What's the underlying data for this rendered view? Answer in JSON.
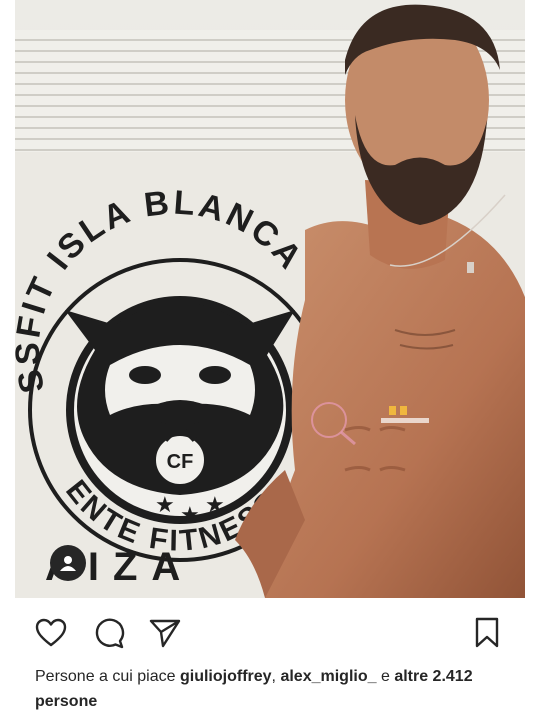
{
  "post": {
    "logo_text_top": "SSFIT ISLA BLANCA",
    "logo_text_bottom": "ENTE FITNESS",
    "logo_text_corner": "AIZA",
    "logo_badge": "CF"
  },
  "actions": {
    "like_icon": "heart-icon",
    "comment_icon": "comment-icon",
    "share_icon": "send-icon",
    "save_icon": "bookmark-icon"
  },
  "likes": {
    "prefix": "Persone a cui piace",
    "user1": "giuliojoffrey",
    "sep": ",",
    "user2": "alex_miglio_",
    "conj": "e",
    "others": "altre 2.412 persone"
  },
  "colors": {
    "text": "#262626",
    "background": "#ffffff"
  }
}
